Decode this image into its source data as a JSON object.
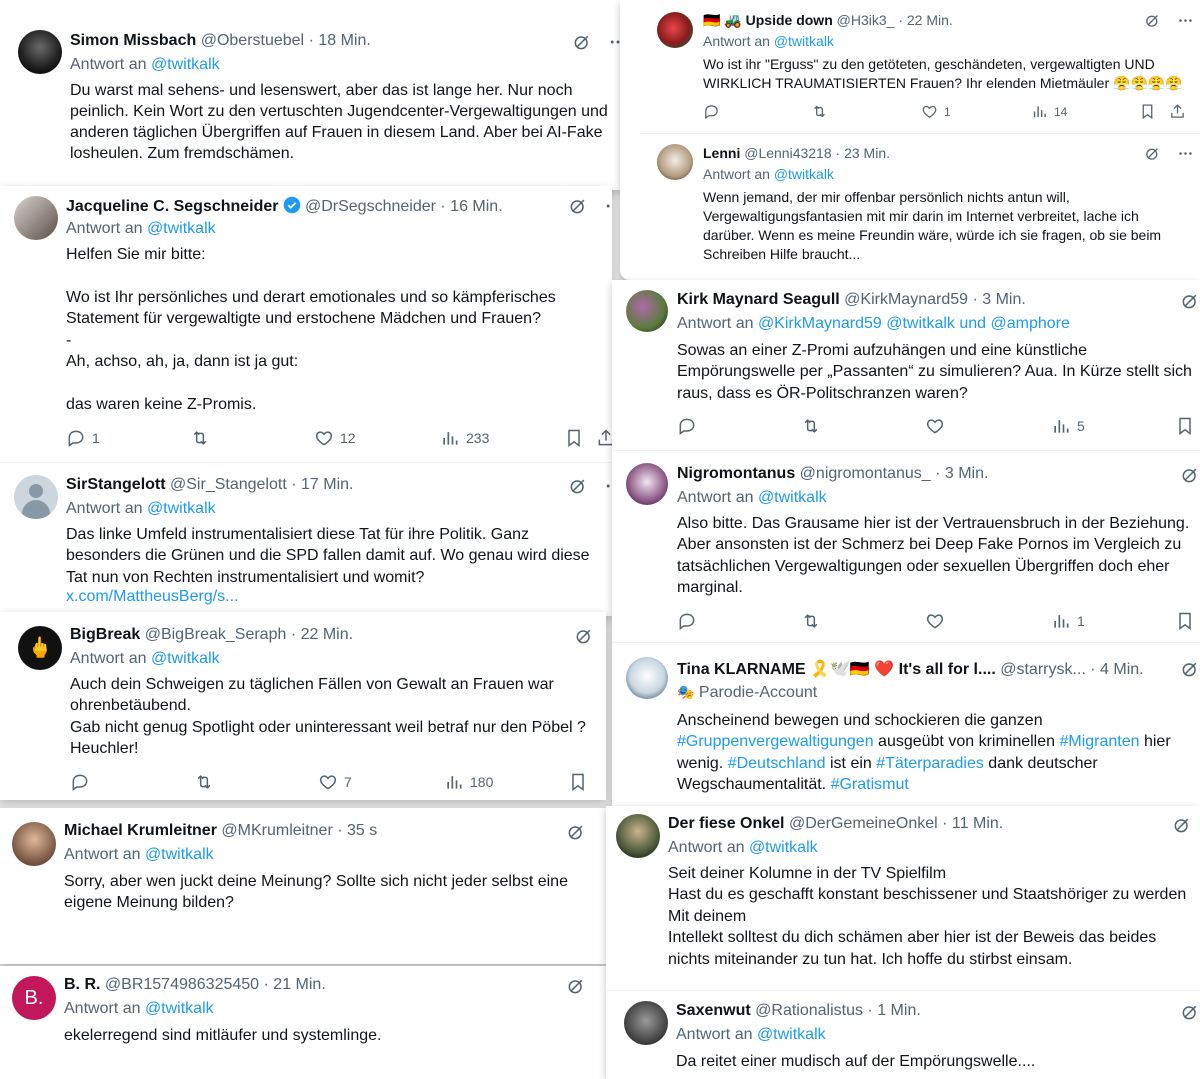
{
  "antwort_label": "Antwort an",
  "c1": {
    "t1": {
      "name": "Simon Missbach",
      "handle": "@Oberstuebel",
      "time": "· 18 Min.",
      "reply_to": "@twitkalk",
      "body": "Du warst mal sehens- und lesenswert, aber das ist lange her. Nur noch peinlich. Kein Wort zu den vertuschten Jugendcenter-Vergewaltigungen und anderen täglichen Übergriffen auf Frauen in diesem Land. Aber bei AI-Fake losheulen. Zum fremdschämen."
    }
  },
  "c2": {
    "t1": {
      "name": "Jacqueline C. Segschneider",
      "handle": "@DrSegschneider",
      "time": "· 16 Min.",
      "reply_to": "@twitkalk",
      "body": "Helfen Sie mir bitte:\n\nWo ist Ihr persönliches und derart emotionales und so kämpferisches Statement für vergewaltigte und erstochene Mädchen und Frauen?\n-\nAh, achso, ah, ja, dann ist ja gut:\n\ndas waren keine Z-Promis.",
      "replies": "1",
      "likes": "12",
      "views": "233"
    },
    "t2": {
      "name": "SirStangelott",
      "handle": "@Sir_Stangelott",
      "time": "· 17 Min.",
      "reply_to": "@twitkalk",
      "body": "Das linke Umfeld instrumentalisiert diese Tat für ihre Politik. Ganz besonders die Grünen und die SPD fallen damit auf. Wo genau wird diese Tat nun von Rechten instrumentalisiert und womit?",
      "link": "x.com/MattheusBerg/s..."
    }
  },
  "c3": {
    "t1": {
      "name": "BigBreak",
      "handle": "@BigBreak_Seraph",
      "time": "· 22 Min.",
      "reply_to": "@twitkalk",
      "body": "Auch dein Schweigen zu täglichen Fällen von Gewalt an Frauen war ohrenbetäubend.\nGab nicht genug Spotlight oder uninteressant weil betraf nur den Pöbel ?\nHeuchler!",
      "likes": "7",
      "views": "180"
    }
  },
  "c4": {
    "t1": {
      "name": "Michael Krumleitner",
      "handle": "@MKrumleitner",
      "time": "· 35 s",
      "reply_to": "@twitkalk",
      "body": "Sorry, aber wen juckt deine Meinung? Sollte sich nicht jeder selbst eine eigene Meinung bilden?"
    }
  },
  "c5": {
    "t1": {
      "name": "B. R.",
      "handle": "@BR1574986325450",
      "time": "· 21 Min.",
      "reply_to": "@twitkalk",
      "avatar_letter": "B.",
      "body": "ekelerregend sind mitläufer und systemlinge."
    }
  },
  "c6": {
    "t1": {
      "name": "🇩🇪 🚜 Upside down",
      "handle": "@H3ik3_",
      "time": "· 22 Min.",
      "reply_to": "@twitkalk",
      "body": "Wo ist ihr \"Erguss\" zu den getöteten, geschändeten, vergewaltigten UND WIRKLICH TRAUMATISIERTEN Frauen? Ihr elenden Mietmäuler 😤😤😤😤",
      "likes": "1",
      "views": "14"
    },
    "t2": {
      "name": "Lenni",
      "handle": "@Lenni43218",
      "time": "· 23 Min.",
      "reply_to": "@twitkalk",
      "body": "Wenn jemand, der mir offenbar persönlich nichts antun will, Vergewaltigungsfantasien mit mir darin im Internet verbreitet, lache ich darüber. Wenn es meine Freundin wäre, würde ich sie fragen, ob sie beim Schreiben Hilfe braucht..."
    }
  },
  "c7": {
    "t1": {
      "name": "Kirk Maynard Seagull",
      "handle": "@KirkMaynard59",
      "time": "· 3 Min.",
      "reply_to": "@KirkMaynard59 @twitkalk und @amphore",
      "body": "Sowas an einer Z-Promi aufzuhängen und eine künstliche Empörungswelle per „Passanten“ zu simulieren? Aua. In Kürze stellt sich raus, dass es ÖR-Politschranzen waren?",
      "views": "5"
    },
    "t2": {
      "name": "Nigromontanus",
      "handle": "@nigromontanus_",
      "time": "· 3 Min.",
      "reply_to": "@twitkalk",
      "body": "Also bitte. Das Grausame hier ist der Vertrauensbruch in der Beziehung. Aber ansonsten ist der Schmerz bei Deep Fake Pornos im Vergleich zu tatsächlichen Vergewaltigungen oder sexuellen Übergriffen doch eher marginal.",
      "views": "1"
    },
    "t3": {
      "name": "Tina KLARNAME 🎗️🕊️🇩🇪 ❤️ It's all for l....",
      "handle": "@starrysk...",
      "time": "· 4 Min.",
      "parody": "Parodie-Account",
      "body_parts": [
        "Anscheinend bewegen und schockieren die ganzen ",
        "#Gruppenvergewaltigungen",
        " ausgeübt von kriminellen ",
        "#Migranten",
        " hier wenig. ",
        "#Deutschland",
        " ist ein ",
        "#Täterparadies",
        " dank deutscher Wegschaumentalität. ",
        "#Gratismut"
      ]
    }
  },
  "c8": {
    "t1": {
      "name": "Der fiese Onkel",
      "handle": "@DerGemeineOnkel",
      "time": "· 11 Min.",
      "reply_to": "@twitkalk",
      "body": "Seit deiner Kolumne in der TV Spielfilm\nHast du es geschafft konstant beschissener und Staatshöriger zu werden\nMit deinem\nIntellekt solltest du dich schämen aber hier ist der Beweis das beides nichts miteinander zu tun hat. Ich hoffe du stirbst einsam."
    },
    "t2": {
      "name": "Saxenwut",
      "handle": "@Rationalistus",
      "time": "· 1 Min.",
      "reply_to": "@twitkalk",
      "body": "Da reitet einer mudisch auf der Empörungswelle...."
    }
  },
  "colors": {
    "accent": "#1d9bf0",
    "muted": "#536471",
    "text": "#0f1419",
    "br_avatar": "#c2185b"
  },
  "icons": [
    "reply-icon",
    "retweet-icon",
    "like-icon",
    "views-icon",
    "bookmark-icon",
    "share-icon",
    "grok-icon",
    "more-icon",
    "verified-icon",
    "parody-icon"
  ]
}
